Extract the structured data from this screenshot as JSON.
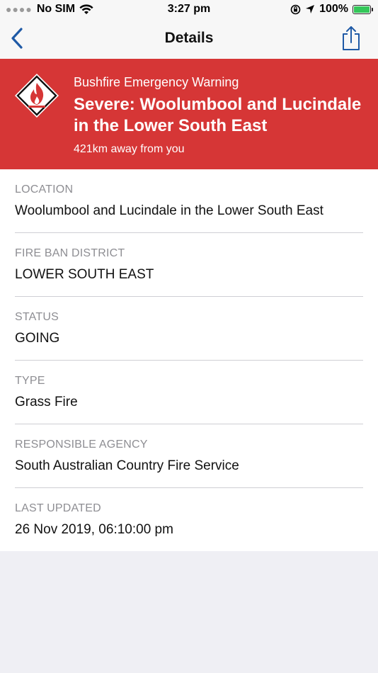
{
  "status_bar": {
    "carrier": "No SIM",
    "time": "3:27 pm",
    "battery": "100%",
    "battery_level": 1.0
  },
  "nav": {
    "title": "Details"
  },
  "warning": {
    "type": "Bushfire Emergency Warning",
    "title": "Severe: Woolumbool and Lucindale in the Lower South East",
    "distance": "421km away from you"
  },
  "details": [
    {
      "label": "LOCATION",
      "value": "Woolumbool and Lucindale in the Lower South East"
    },
    {
      "label": "FIRE BAN DISTRICT",
      "value": "LOWER SOUTH EAST"
    },
    {
      "label": "STATUS",
      "value": "GOING"
    },
    {
      "label": "TYPE",
      "value": "Grass Fire"
    },
    {
      "label": "RESPONSIBLE AGENCY",
      "value": "South Australian Country Fire Service"
    },
    {
      "label": "LAST UPDATED",
      "value": "26 Nov 2019, 06:10:00 pm"
    }
  ],
  "colors": {
    "header_red": "#d63636",
    "accent_blue": "#1f5aa6",
    "battery_green": "#34c759"
  }
}
